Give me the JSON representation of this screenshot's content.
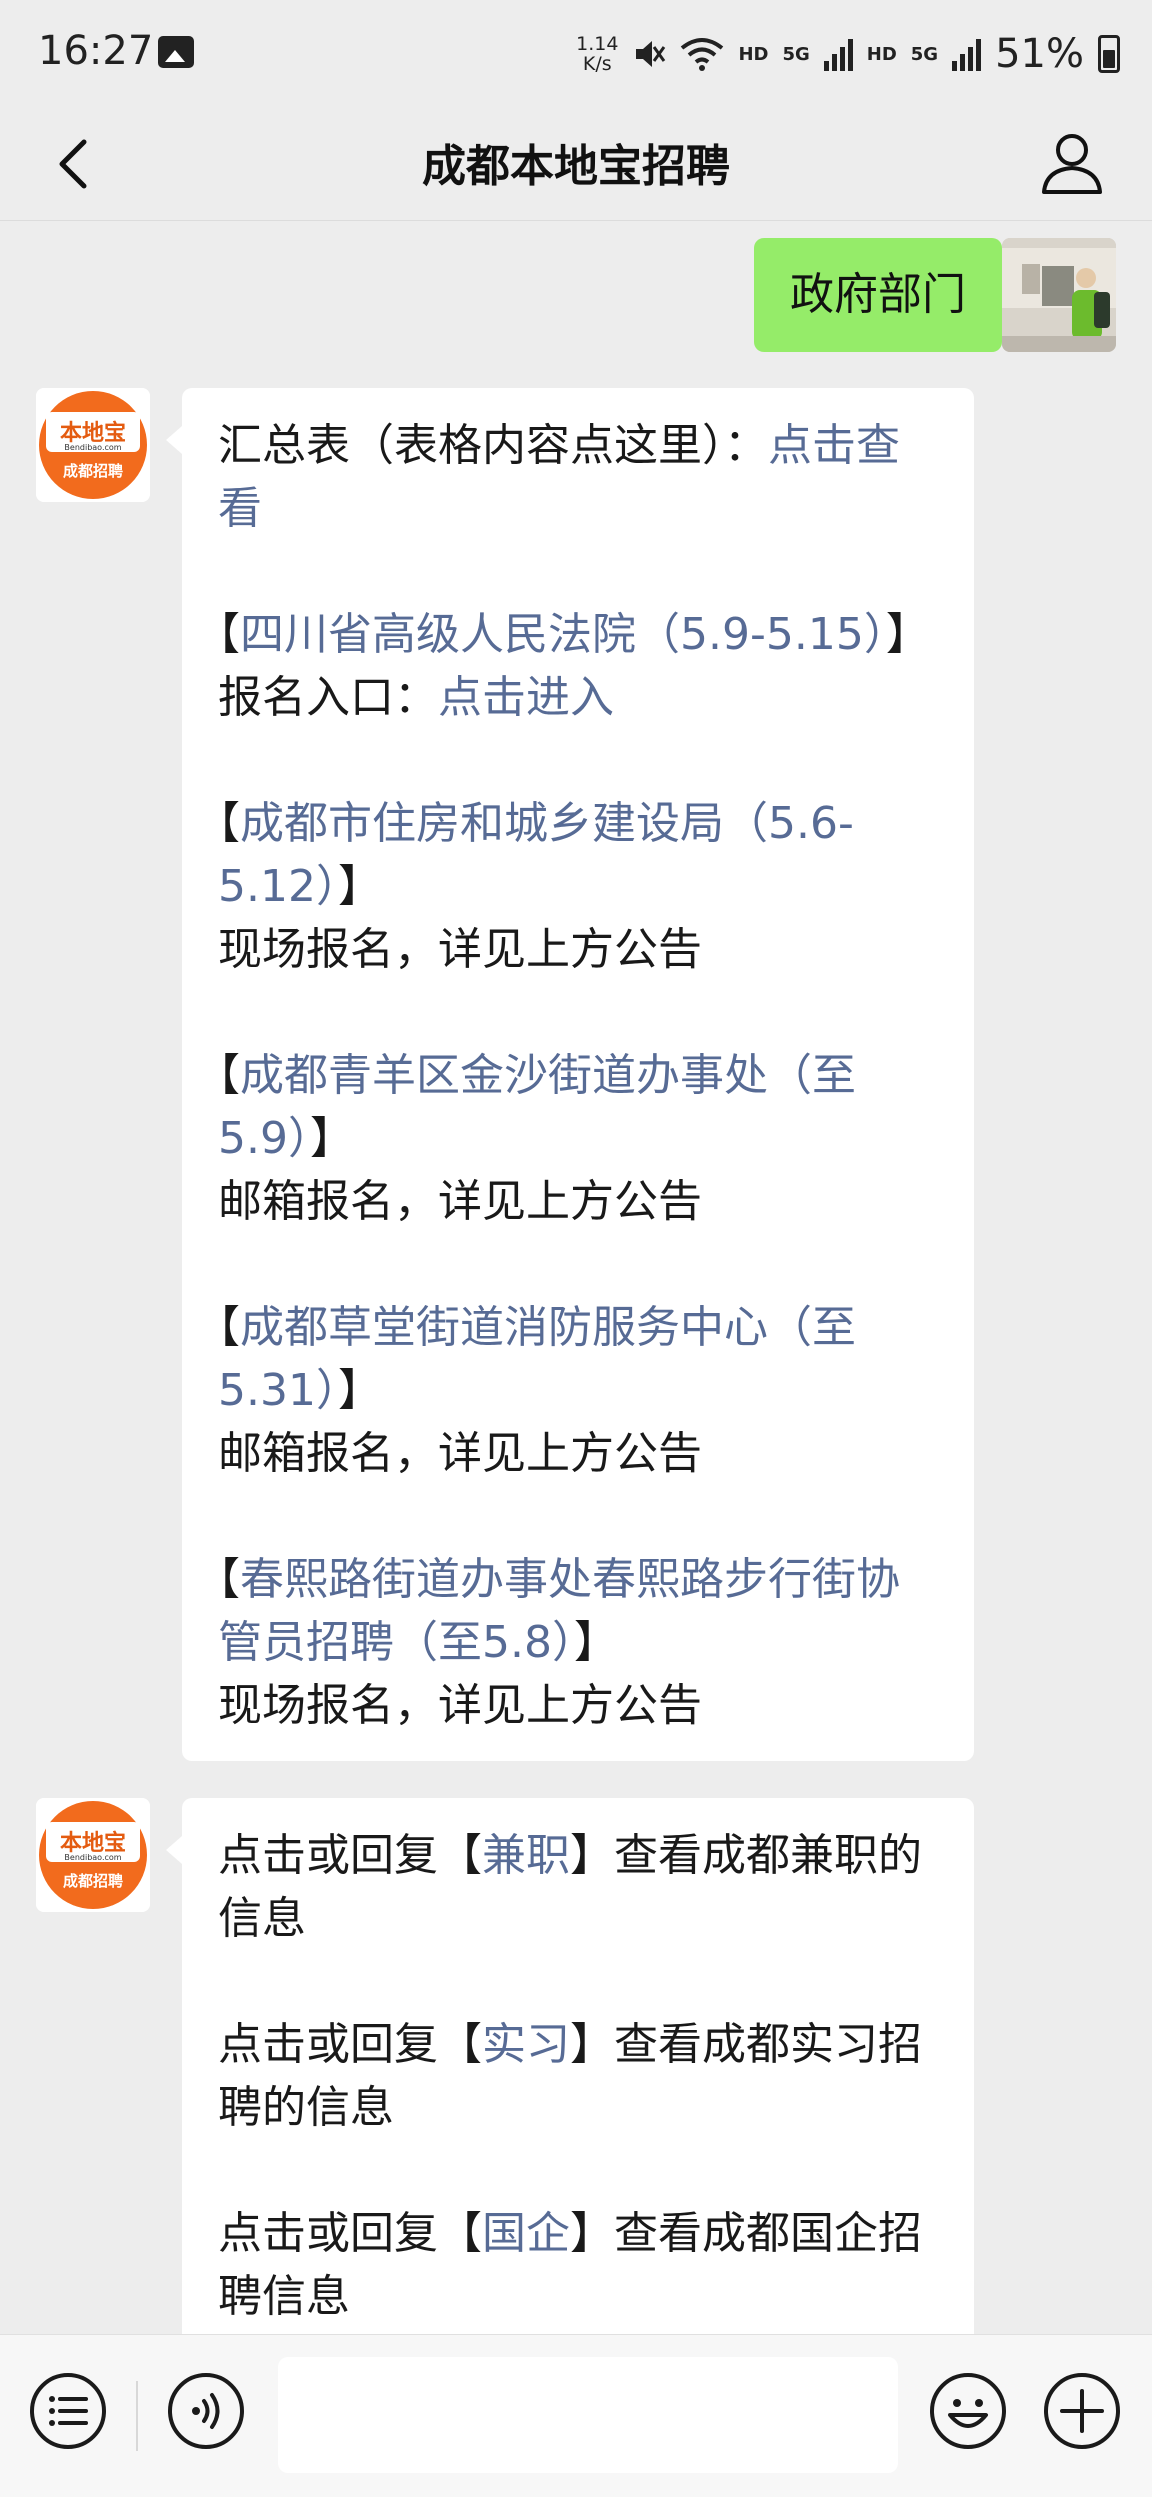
{
  "status_bar": {
    "time": "16:27",
    "net_speed_value": "1.14",
    "net_speed_unit": "K/s",
    "hd1": "HD",
    "sig1": "5G",
    "hd2": "HD",
    "sig2": "5G",
    "battery": "51%"
  },
  "nav": {
    "title": "成都本地宝招聘"
  },
  "my_message": {
    "text": "政府部门"
  },
  "bot": {
    "logo_top": "本地宝",
    "logo_mid": "Bendibao.com",
    "logo_bottom": "成都招聘"
  },
  "message1": {
    "summary_prefix": "汇总表（表格内容点这里）：",
    "summary_link": "点击查看",
    "items": [
      {
        "open": "【",
        "name": "四川省高级人民法院（5.9-5.15）",
        "close": "】",
        "note_prefix": "报名入口：",
        "note_link": "点击进入"
      },
      {
        "open": "【",
        "name": "成都市住房和城乡建设局（5.6-5.12）",
        "close": "】",
        "note": "现场报名，详见上方公告"
      },
      {
        "open": "【",
        "name": "成都青羊区金沙街道办事处（至5.9）",
        "close": "】",
        "note": "邮箱报名，详见上方公告"
      },
      {
        "open": "【",
        "name": "成都草堂街道消防服务中心（至5.31）",
        "close": "】",
        "note": "邮箱报名，详见上方公告"
      },
      {
        "open": "【",
        "name": "春熙路街道办事处春熙路步行街协管员招聘（至5.8）",
        "close": "】",
        "note": "现场报名，详见上方公告"
      }
    ]
  },
  "message2": {
    "items": [
      {
        "prefix": "点击或回复【",
        "keyword": "兼职",
        "suffix": "】查看成都兼职的信息"
      },
      {
        "prefix": "点击或回复【",
        "keyword": "实习",
        "suffix": "】查看成都实习招聘的信息"
      },
      {
        "prefix": "点击或回复【",
        "keyword": "国企",
        "suffix": "】查看成都国企招聘信息"
      }
    ]
  },
  "icons": {
    "back": "chevron-left-icon",
    "user": "person-icon",
    "menu": "list-menu-icon",
    "voice": "voice-icon",
    "emoji": "emoji-icon",
    "plus": "plus-icon"
  },
  "colors": {
    "background": "#ededed",
    "my_bubble": "#95ec69",
    "link": "#576b95",
    "logo_orange": "#f26b1d"
  }
}
